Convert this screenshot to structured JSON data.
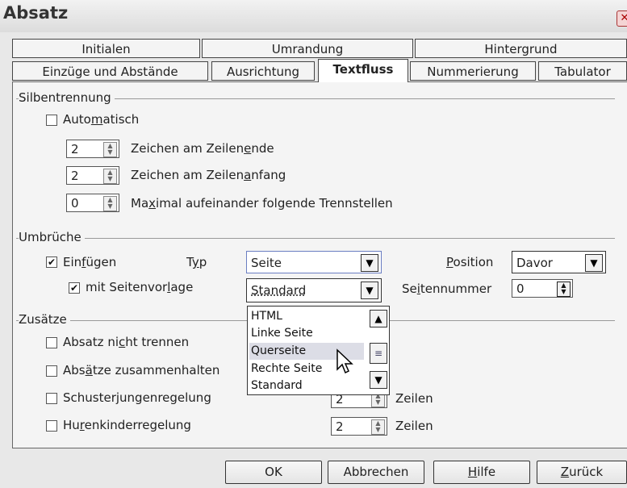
{
  "window": {
    "title": "Absatz",
    "close_glyph": "✕"
  },
  "tabs_row1": [
    "Initialen",
    "Umrandung",
    "Hintergrund"
  ],
  "tabs_row2": [
    "Einzüge und Abstände",
    "Ausrichtung",
    "Textfluss",
    "Nummerierung",
    "Tabulator"
  ],
  "hyphenation": {
    "group_label": "Silbentrennung",
    "auto": {
      "pre": "Auto",
      "u": "m",
      "post": "atisch",
      "checked": false
    },
    "spin1": {
      "value": "2",
      "pre": "Zeichen am Zeilen",
      "u": "e",
      "post": "nde"
    },
    "spin2": {
      "value": "2",
      "pre": "Zeichen am Zeilen",
      "u": "a",
      "post": "nfang"
    },
    "spin3": {
      "value": "0",
      "pre": "Ma",
      "u": "x",
      "post": "imal aufeinander folgende Trennstellen"
    }
  },
  "breaks": {
    "group_label": "Umbrüche",
    "insert": {
      "pre": "Ein",
      "u": "f",
      "post": "ügen",
      "checked": true
    },
    "type_label": {
      "pre": "T",
      "u": "y",
      "post": "p"
    },
    "type_value": "Seite",
    "position_label": {
      "pre": "",
      "u": "P",
      "post": "osition"
    },
    "position_value": "Davor",
    "with_style": {
      "pre": "mit Seitenvor",
      "u": "l",
      "post": "age",
      "checked": true
    },
    "style_value": "Standard",
    "page_number_label": {
      "pre": "Se",
      "u": "i",
      "post": "tennummer"
    },
    "page_number_value": "0"
  },
  "dropdown_list": {
    "items": [
      "HTML",
      "Linke Seite",
      "Querseite",
      "Rechte Seite",
      "Standard"
    ],
    "hovered": "Querseite"
  },
  "options": {
    "group_label": "Zusätze",
    "keep_together": {
      "pre": "Absatz ni",
      "u": "c",
      "post": "ht trennen",
      "checked": false
    },
    "keep_with_next": {
      "pre": "Abs",
      "u": "ä",
      "post": "tze zusammenhalten",
      "checked": false
    },
    "orphan": {
      "pre": "Schuster",
      "u": "j",
      "post": "ungenregelung",
      "checked": false,
      "value": "2",
      "unit": "Zeilen"
    },
    "widow": {
      "pre": "Hu",
      "u": "r",
      "post": "enkinderregelung",
      "checked": false,
      "value": "2",
      "unit": "Zeilen"
    }
  },
  "buttons": {
    "ok": "OK",
    "cancel": "Abbrechen",
    "help": {
      "pre": "",
      "u": "H",
      "post": "ilfe"
    },
    "back": {
      "pre": "",
      "u": "Z",
      "post": "urück"
    }
  }
}
